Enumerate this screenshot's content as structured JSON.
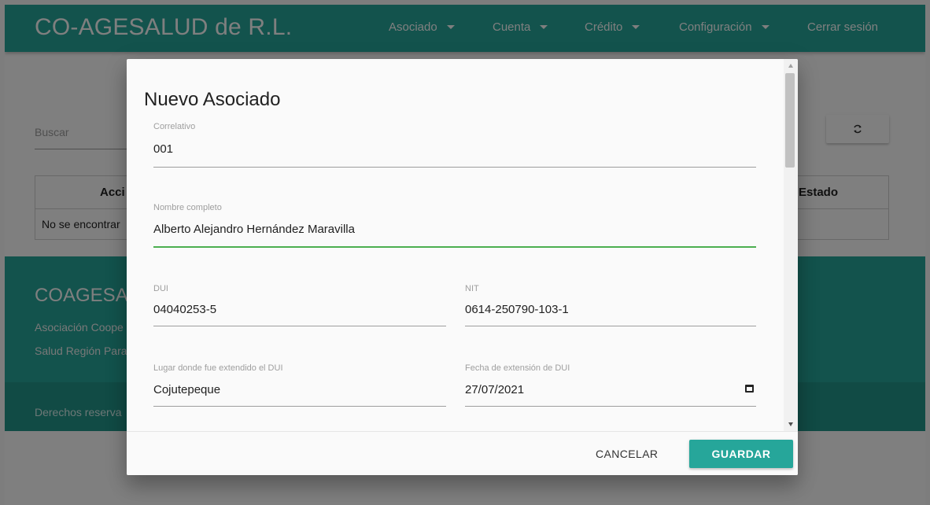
{
  "navbar": {
    "brand": "CO-AGESALUD de R.L.",
    "items": [
      {
        "label": "Asociado",
        "has_caret": true
      },
      {
        "label": "Cuenta",
        "has_caret": true
      },
      {
        "label": "Crédito",
        "has_caret": true
      },
      {
        "label": "Configuración",
        "has_caret": true
      },
      {
        "label": "Cerrar sesión",
        "has_caret": false
      }
    ]
  },
  "main": {
    "search_placeholder": "Buscar",
    "refresh_icon": "refresh-icon",
    "table": {
      "headers": {
        "acciones": "Acci",
        "estado": "Estado"
      },
      "empty_text": "No se encontrar"
    }
  },
  "footer": {
    "title": "COAGESAl",
    "line1": "Asociación Coope",
    "line2": "Salud Región Para",
    "copyright": "Derechos reserva"
  },
  "modal": {
    "title": "Nuevo Asociado",
    "fields": {
      "correlativo": {
        "label": "Correlativo",
        "value": "001"
      },
      "nombre": {
        "label": "Nombre completo",
        "value": "Alberto Alejandro Hernández Maravilla"
      },
      "dui": {
        "label": "DUI",
        "value": "04040253-5"
      },
      "nit": {
        "label": "NIT",
        "value": "0614-250790-103-1"
      },
      "lugar_dui": {
        "label": "Lugar donde fue extendido el DUI",
        "value": "Cojutepeque"
      },
      "fecha_dui": {
        "label": "Fecha de extensión de DUI",
        "value": "27/07/2021"
      }
    },
    "buttons": {
      "cancel": "CANCELAR",
      "save": "GUARDAR"
    }
  },
  "colors": {
    "primary": "#26a69a",
    "focus_underline": "#4caf50"
  }
}
